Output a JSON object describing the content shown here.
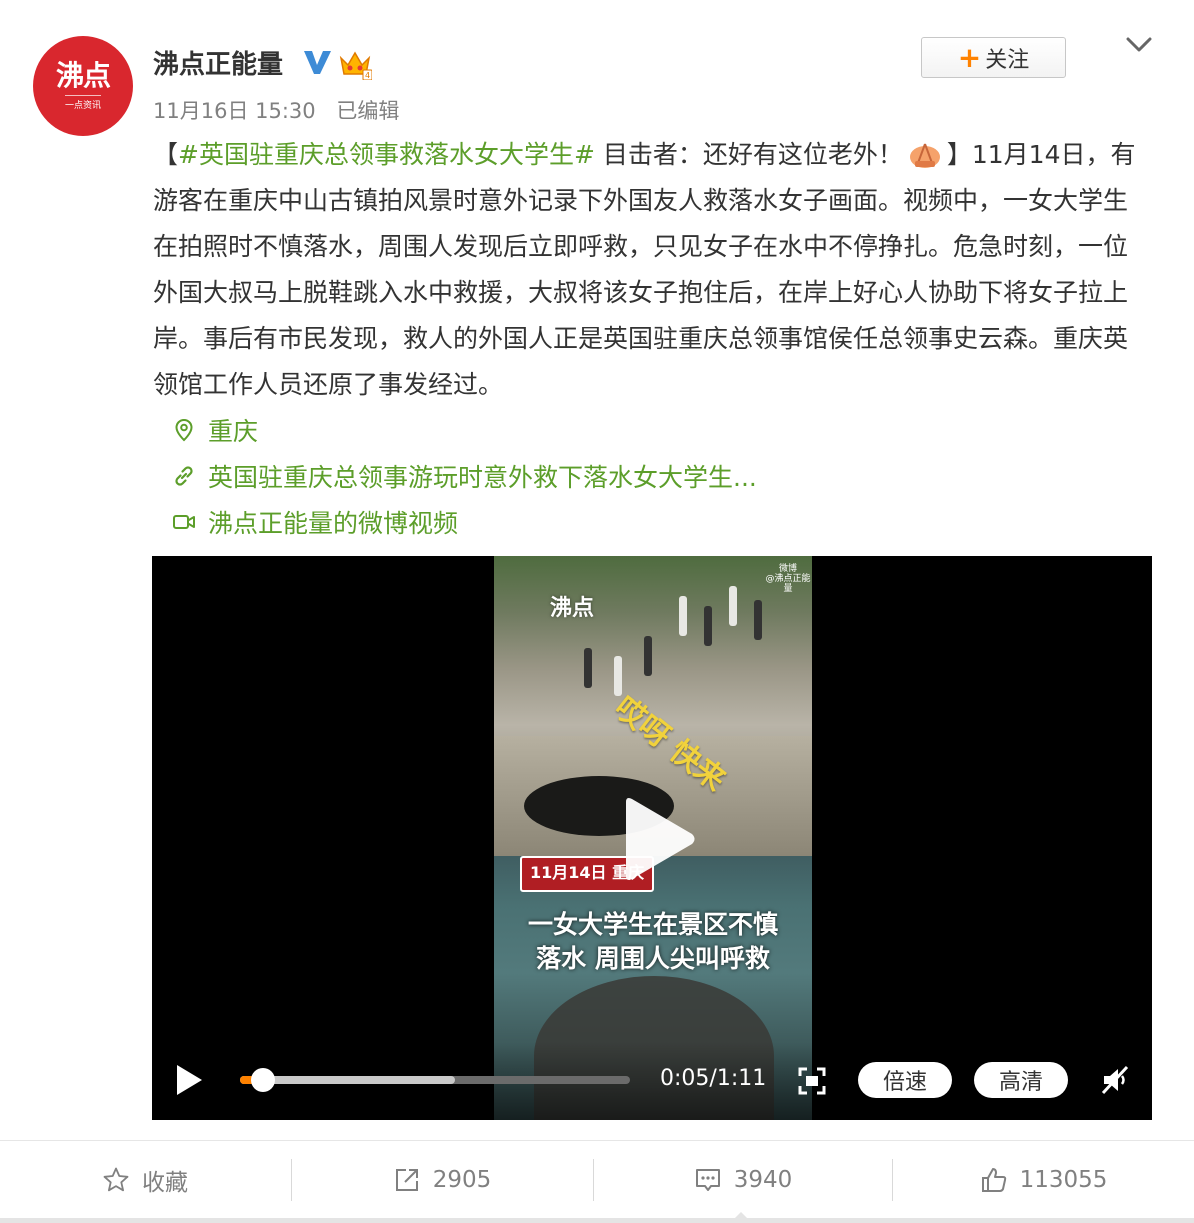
{
  "author": {
    "name": "沸点正能量",
    "avatar_logo": "沸点",
    "avatar_sub": "一点资讯",
    "verified_icon": "verified-v-icon",
    "member_icon": "crown-icon"
  },
  "meta": {
    "time": "11月16日 15:30",
    "edited": "已编辑"
  },
  "follow": {
    "plus": "+",
    "label": "关注"
  },
  "post": {
    "bracket_open": "【",
    "hashtag": "#英国驻重庆总领事救落水女大学生#",
    "lead": " 目击者：还好有这位老外！",
    "emoji": "pray-hands-emoji",
    "body": "】11月14日，有游客在重庆中山古镇拍风景时意外记录下外国友人救落水女子画面。视频中，一女大学生在拍照时不慎落水，周围人发现后立即呼救，只见女子在水中不停挣扎。危急时刻，一位外国大叔马上脱鞋跳入水中救援，大叔将该女子抱住后，在岸上好心人协助下将女子拉上岸。事后有市民发现，救人的外国人正是英国驻重庆总领事馆侯任总领事史云森。重庆英领馆工作人员还原了事发经过。"
  },
  "links": {
    "location": "重庆",
    "article": "英国驻重庆总领事游玩时意外救下落水女大学生...",
    "video_source": "沸点正能量的微博视频"
  },
  "video": {
    "watermark_logo": "沸点",
    "watermark_weibo": "微博",
    "watermark_sub": "@沸点正能量",
    "overlay_exclaim": "哎呀 快来",
    "date_tag": "11月14日 重庆",
    "caption_line1": "一女大学生在景区不慎",
    "caption_line2": "落水 周围人尖叫呼救",
    "time": "0:05/1:11",
    "progress_played": 0.06,
    "progress_buffered": 0.55,
    "speed_label": "倍速",
    "quality_label": "高清"
  },
  "footer": {
    "favorite_label": "收藏",
    "share_count": "2905",
    "comment_count": "3940",
    "like_count": "113055"
  },
  "colors": {
    "accent_orange": "#ff8200",
    "link_green": "#5c9e2a",
    "brand_red": "#d9272e",
    "verified_blue": "#3d8bd6"
  }
}
